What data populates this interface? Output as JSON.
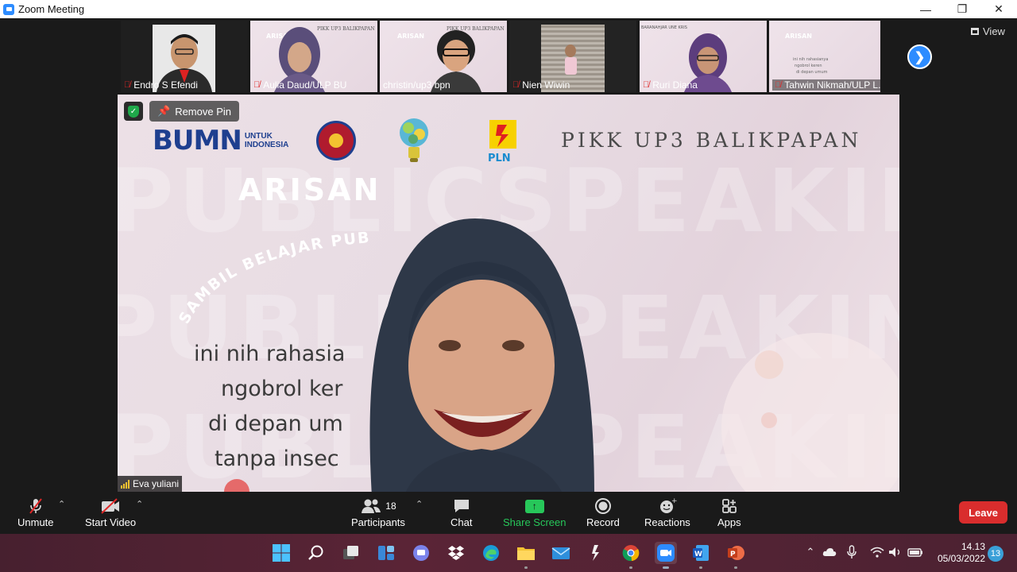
{
  "window": {
    "title": "Zoom Meeting",
    "controls": [
      "minimize",
      "maximize",
      "close"
    ]
  },
  "top_bar": {
    "view_label": "View"
  },
  "participants_strip": [
    {
      "name": "Endro S Efendi",
      "muted": true
    },
    {
      "name": "Aulia Daud/ULP BU",
      "muted": true
    },
    {
      "name": "christin/up3 bpn",
      "muted": false
    },
    {
      "name": "Nien Wiwin",
      "muted": true
    },
    {
      "name": "Ruri Diana",
      "muted": true
    },
    {
      "name": "Tahwin Nikmah/ULP L...",
      "muted": true
    }
  ],
  "main_video": {
    "remove_pin_label": "Remove Pin",
    "speaker_name": "Eva yuliani",
    "slide": {
      "bumn_logo": "BUMN",
      "bumn_sub_1": "UNTUK",
      "bumn_sub_2": "INDONESIA",
      "pln_label": "PLN",
      "org_title": "PIKK UP3 BALIKPAPAN",
      "heading": "ARISAN",
      "arc_text": "SAMBIL BELAJAR PUBLIC SPE",
      "lines": [
        "ini nih rahasia",
        "ngobrol ker",
        "di depan um",
        "tanpa insec"
      ]
    }
  },
  "toolbar": {
    "unmute": "Unmute",
    "start_video": "Start Video",
    "participants": "Participants",
    "participants_count": "18",
    "chat": "Chat",
    "share_screen": "Share Screen",
    "record": "Record",
    "reactions": "Reactions",
    "apps": "Apps",
    "leave": "Leave",
    "share_color": "#27c75a",
    "leave_color": "#d92d2d"
  },
  "taskbar": {
    "apps": [
      "windows-start",
      "search",
      "task-view",
      "widgets",
      "teams-chat",
      "dropbox",
      "edge",
      "file-explorer",
      "mail",
      "winamp",
      "chrome",
      "zoom",
      "word",
      "powerpoint"
    ],
    "time": "14.13",
    "date": "05/03/2022",
    "notification_count": "13"
  }
}
